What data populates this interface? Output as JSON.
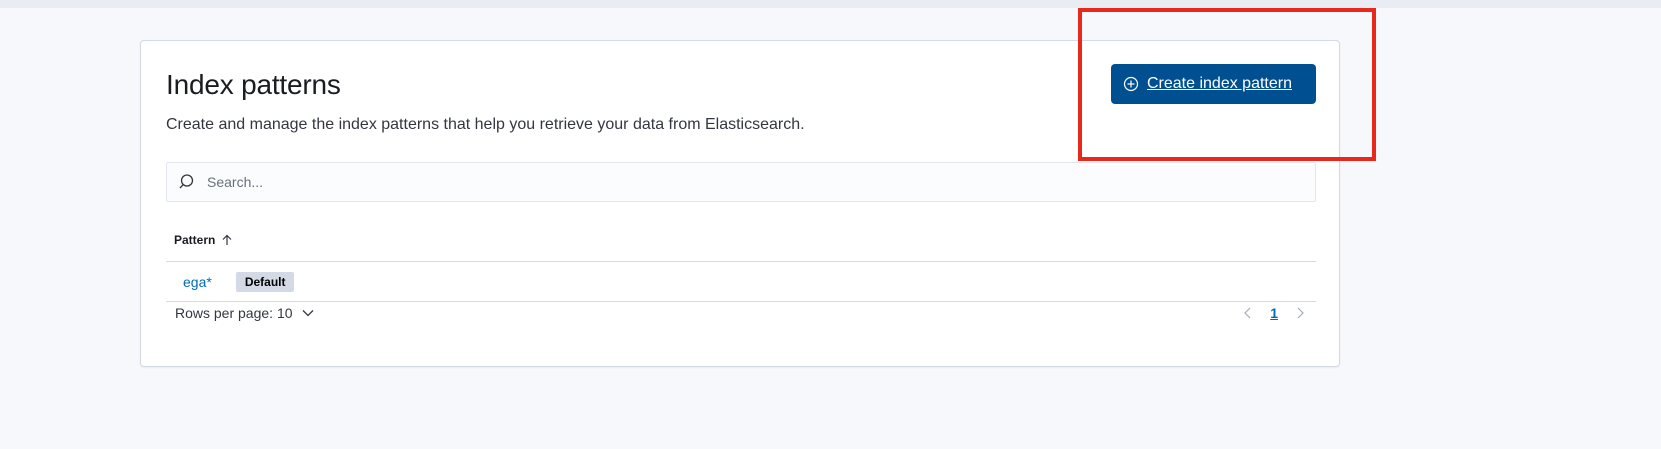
{
  "page": {
    "title": "Index patterns",
    "description": "Create and manage the index patterns that help you retrieve your data from Elasticsearch."
  },
  "actions": {
    "create_label": "Create index pattern",
    "create_icon": "plus-in-circle-icon"
  },
  "search": {
    "placeholder": "Search...",
    "value": "",
    "icon": "search-icon"
  },
  "table": {
    "columns": [
      {
        "label": "Pattern",
        "sort": "ascending"
      }
    ],
    "rows": [
      {
        "pattern": "ega*",
        "badge": "Default"
      }
    ]
  },
  "footer": {
    "rows_per_page": "Rows per page: 10",
    "current_page": "1"
  },
  "colors": {
    "primary": "#005091",
    "link": "#006bb8",
    "highlight": "#e7281b",
    "badge_bg": "#d3dae6"
  }
}
